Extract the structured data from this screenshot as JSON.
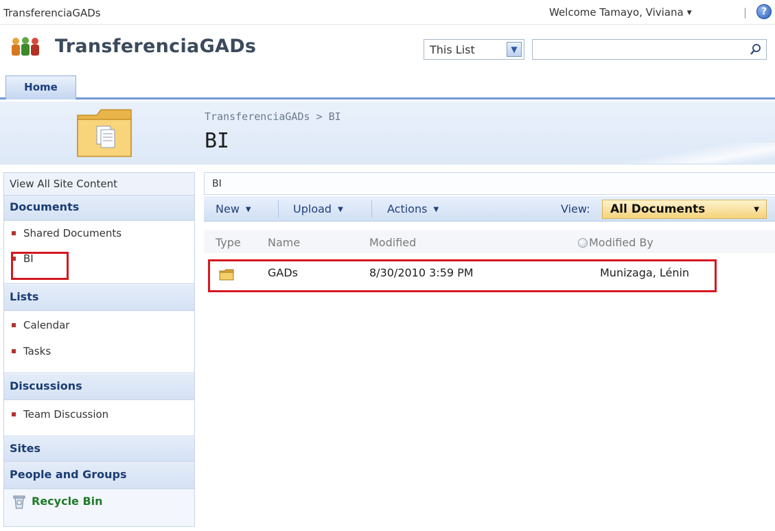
{
  "topbar": {
    "site_name": "TransferenciaGADs",
    "welcome": "Welcome Tamayo, Viviana",
    "separator": "|",
    "help_glyph": "?"
  },
  "header": {
    "title": "TransferenciaGADs",
    "logo_icon": "people-icon",
    "search_scope": "This List",
    "search_value": ""
  },
  "tabs": [
    {
      "label": "Home",
      "selected": true
    }
  ],
  "title_area": {
    "breadcrumb": "TransferenciaGADs > BI",
    "page_title": "BI",
    "icon": "folder-icon"
  },
  "leftnav": {
    "view_all": "View All Site Content",
    "sections": [
      {
        "heading": "Documents",
        "items": [
          "Shared Documents",
          "BI"
        ]
      },
      {
        "heading": "Lists",
        "items": [
          "Calendar",
          "Tasks"
        ]
      },
      {
        "heading": "Discussions",
        "items": [
          "Team Discussion"
        ]
      },
      {
        "heading": "Sites",
        "items": []
      },
      {
        "heading": "People and Groups",
        "items": []
      }
    ],
    "recycle_bin": "Recycle Bin"
  },
  "list": {
    "webpart_title": "BI",
    "toolbar": {
      "new": "New",
      "upload": "Upload",
      "actions": "Actions",
      "view_label": "View:",
      "view_value": "All Documents"
    },
    "columns": [
      "Type",
      "Name",
      "Modified",
      "Modified By"
    ],
    "rows": [
      {
        "type": "folder",
        "name": "GADs",
        "modified": "8/30/2010 3:59 PM",
        "modified_by": "Munizaga, Lénin"
      }
    ]
  },
  "colors": {
    "accent_blue": "#6f99d4",
    "nav_heading": "#1b3c72",
    "view_select": "#f5d27c",
    "highlight_red": "#d4171f",
    "recycle_green": "#207a2a"
  }
}
